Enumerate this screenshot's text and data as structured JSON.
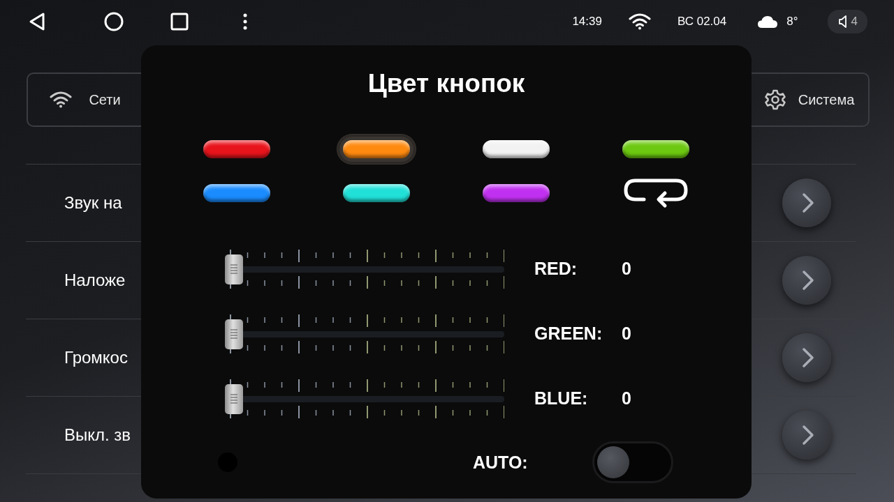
{
  "status_bar": {
    "time": "14:39",
    "date": "ВС 02.04",
    "temperature": "8°",
    "volume": "4"
  },
  "tabs": [
    {
      "label": "Сети",
      "selected": false
    },
    {
      "label": "Система",
      "selected": false
    }
  ],
  "settings_rows": [
    {
      "label": "Звук на"
    },
    {
      "label": "Наложе"
    },
    {
      "label": "Громкос"
    },
    {
      "label": "Выкл. зв"
    }
  ],
  "dialog": {
    "title": "Цвет кнопок",
    "swatches": [
      {
        "kind": "swatch",
        "color": "#e8141c",
        "selected": false
      },
      {
        "kind": "swatch",
        "color": "#ff8a10",
        "selected": true
      },
      {
        "kind": "swatch",
        "color": "#f2f2f2",
        "selected": false
      },
      {
        "kind": "swatch",
        "color": "#6cc810",
        "selected": false
      },
      {
        "kind": "swatch",
        "color": "#1a8cff",
        "selected": false
      },
      {
        "kind": "swatch",
        "color": "#20e0d8",
        "selected": false
      },
      {
        "kind": "swatch",
        "color": "#c030f0",
        "selected": false
      },
      {
        "kind": "cycle",
        "selected": false
      }
    ],
    "channels": [
      {
        "label": "RED:",
        "value": "0",
        "level": 0
      },
      {
        "label": "GREEN:",
        "value": "0",
        "level": 0
      },
      {
        "label": "BLUE:",
        "value": "0",
        "level": 0
      }
    ],
    "auto": {
      "label": "AUTO:",
      "on": false
    }
  }
}
